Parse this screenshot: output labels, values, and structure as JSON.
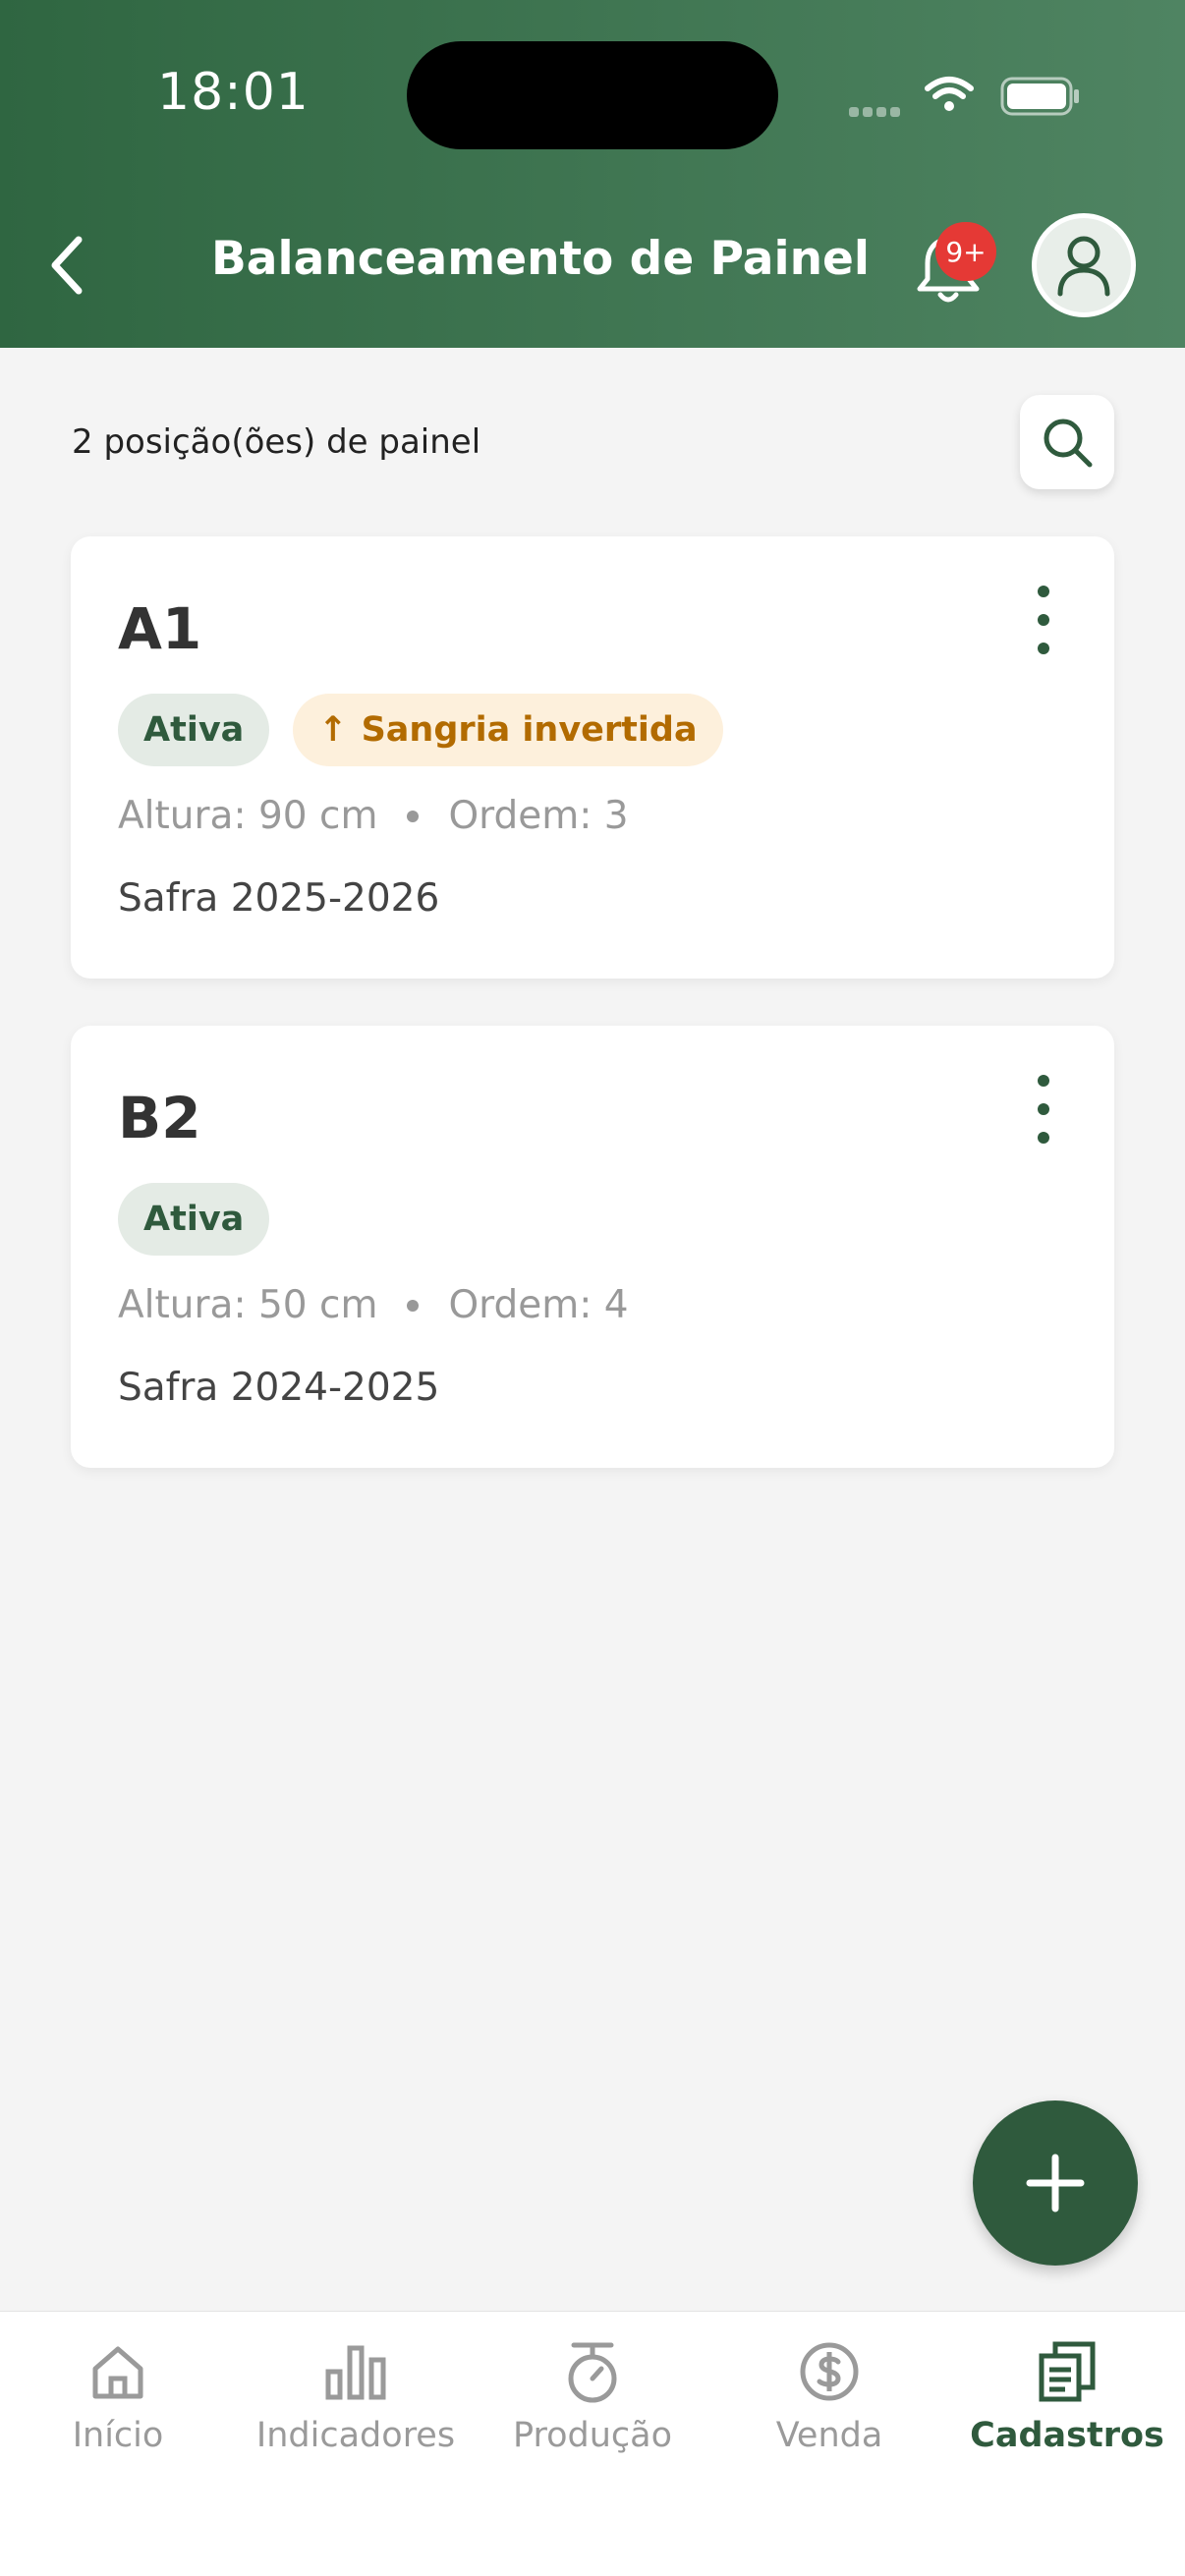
{
  "status_bar": {
    "time": "18:01"
  },
  "header": {
    "title": "Balanceamento de Painel",
    "notification_badge": "9+",
    "back_icon": "chevron-left-icon",
    "bell_icon": "bell-icon",
    "avatar_icon": "user-icon"
  },
  "list": {
    "count_label": "2 posição(ões) de painel",
    "items": [
      {
        "title": "A1",
        "status": "Ativa",
        "tag": "Sangria invertida",
        "tag_arrow": "↑",
        "altura": "Altura: 90 cm",
        "ordem": "Ordem: 3",
        "safra": "Safra 2025-2026"
      },
      {
        "title": "B2",
        "status": "Ativa",
        "altura": "Altura: 50 cm",
        "ordem": "Ordem: 4",
        "safra": "Safra 2024-2025"
      }
    ]
  },
  "fab": {
    "icon": "plus-icon"
  },
  "bottom_nav": {
    "items": [
      {
        "label": "Início",
        "icon": "home-icon"
      },
      {
        "label": "Indicadores",
        "icon": "bar-chart-icon"
      },
      {
        "label": "Produção",
        "icon": "scale-icon"
      },
      {
        "label": "Venda",
        "icon": "dollar-icon"
      },
      {
        "label": "Cadastros",
        "icon": "documents-icon",
        "active": true
      }
    ]
  },
  "colors": {
    "primary": "#2f5a3d",
    "header_start": "#2f6641",
    "header_end": "#4f8462",
    "badge_red": "#e53935",
    "chip_ativa_bg": "#e4ebe5",
    "chip_sangria_bg": "#fdf0dc",
    "chip_sangria_text": "#b26b00"
  }
}
